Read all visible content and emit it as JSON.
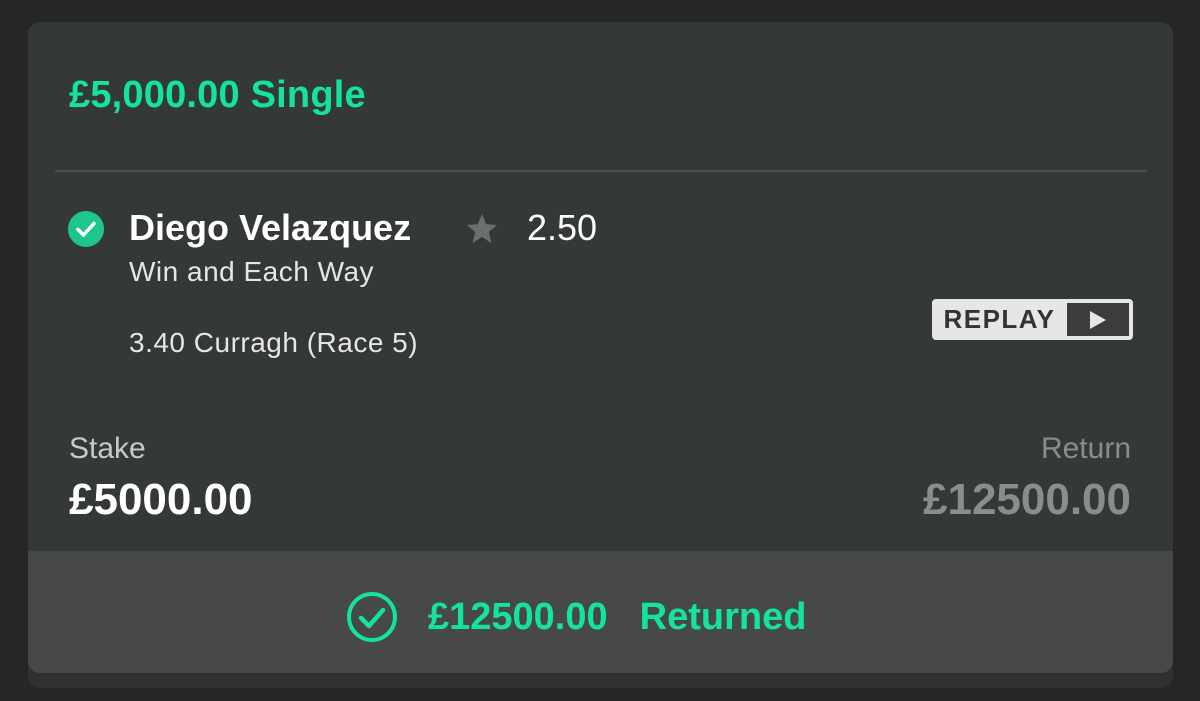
{
  "bet": {
    "title": "£5,000.00 Single",
    "selection": "Diego Velazquez",
    "odds": "2.50",
    "market": "Win and Each Way",
    "event": "3.40 Curragh (Race 5)",
    "replay_label": "REPLAY",
    "stake_label": "Stake",
    "stake_value": "£5000.00",
    "return_label": "Return",
    "return_value": "£12500.00",
    "returned_amount": "£12500.00",
    "returned_label": "Returned"
  },
  "colors": {
    "accent": "#14e3a0",
    "check_fill": "#1ec68c",
    "card_bg": "#343837",
    "footer_bg": "#474848"
  },
  "icons": {
    "selection_status": "check-circle-icon",
    "favourite": "star-icon",
    "replay": "play-icon",
    "returned_status": "check-circle-outline-icon"
  }
}
